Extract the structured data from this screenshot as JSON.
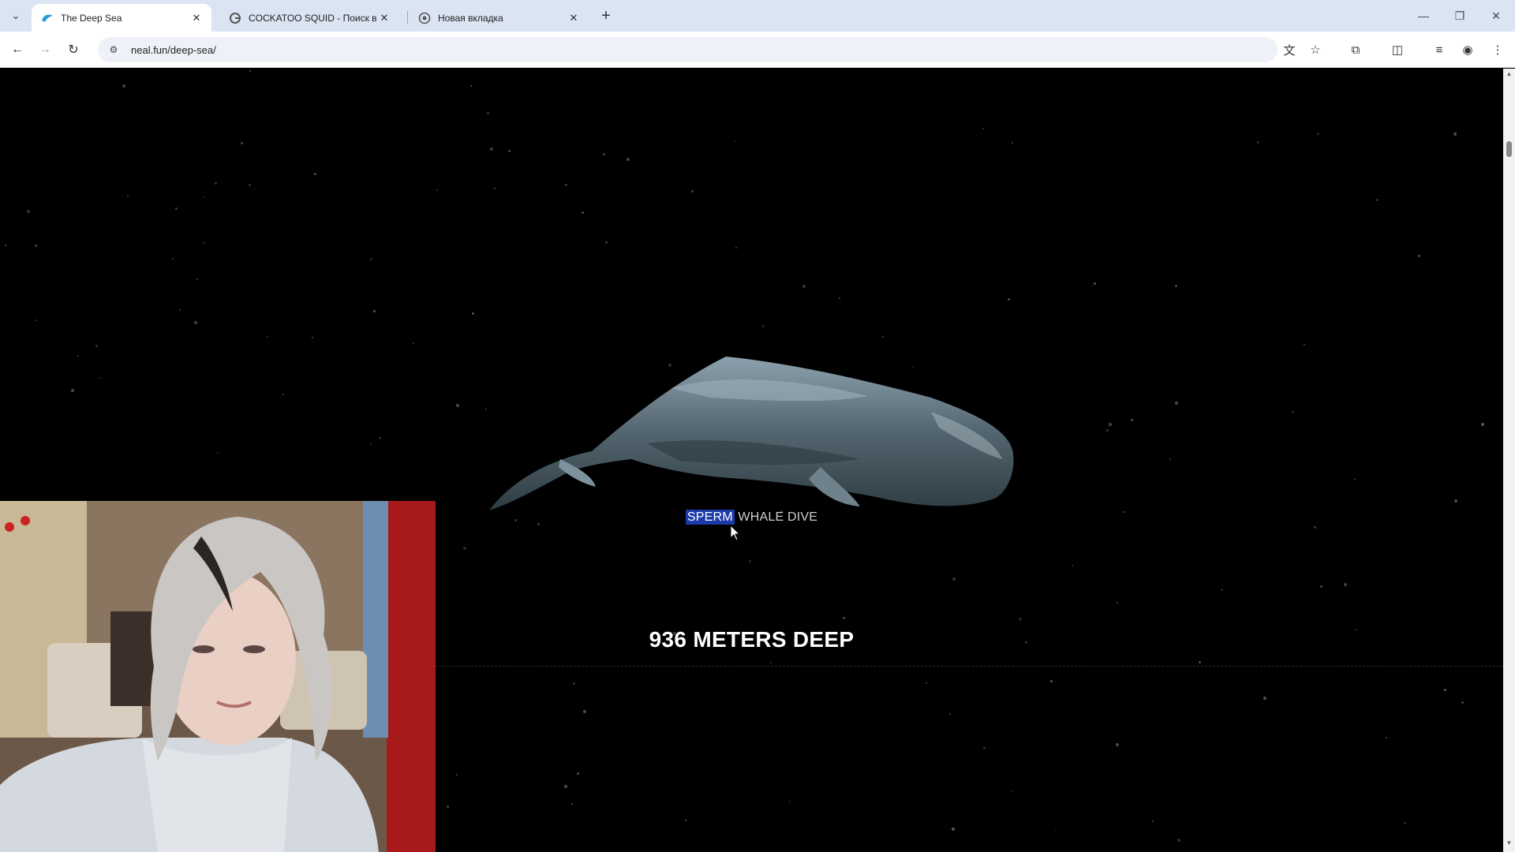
{
  "browser": {
    "tabs": [
      {
        "title": "The Deep Sea",
        "active": true,
        "icon": "deep-sea-favicon"
      },
      {
        "title": "COCKATOO SQUID - Поиск в G",
        "active": false,
        "icon": "google-favicon"
      },
      {
        "title": "Новая вкладка",
        "active": false,
        "icon": "chrome-favicon"
      }
    ],
    "url": "neal.fun/deep-sea/"
  },
  "page": {
    "creature_label_selected": "SPERM",
    "creature_label_rest": " WHALE DIVE",
    "depth_text": "936 METERS DEEP"
  },
  "colors": {
    "page_bg": "#000000",
    "selection": "#1c3aa9",
    "tabbar_bg": "#dbe4f3"
  }
}
